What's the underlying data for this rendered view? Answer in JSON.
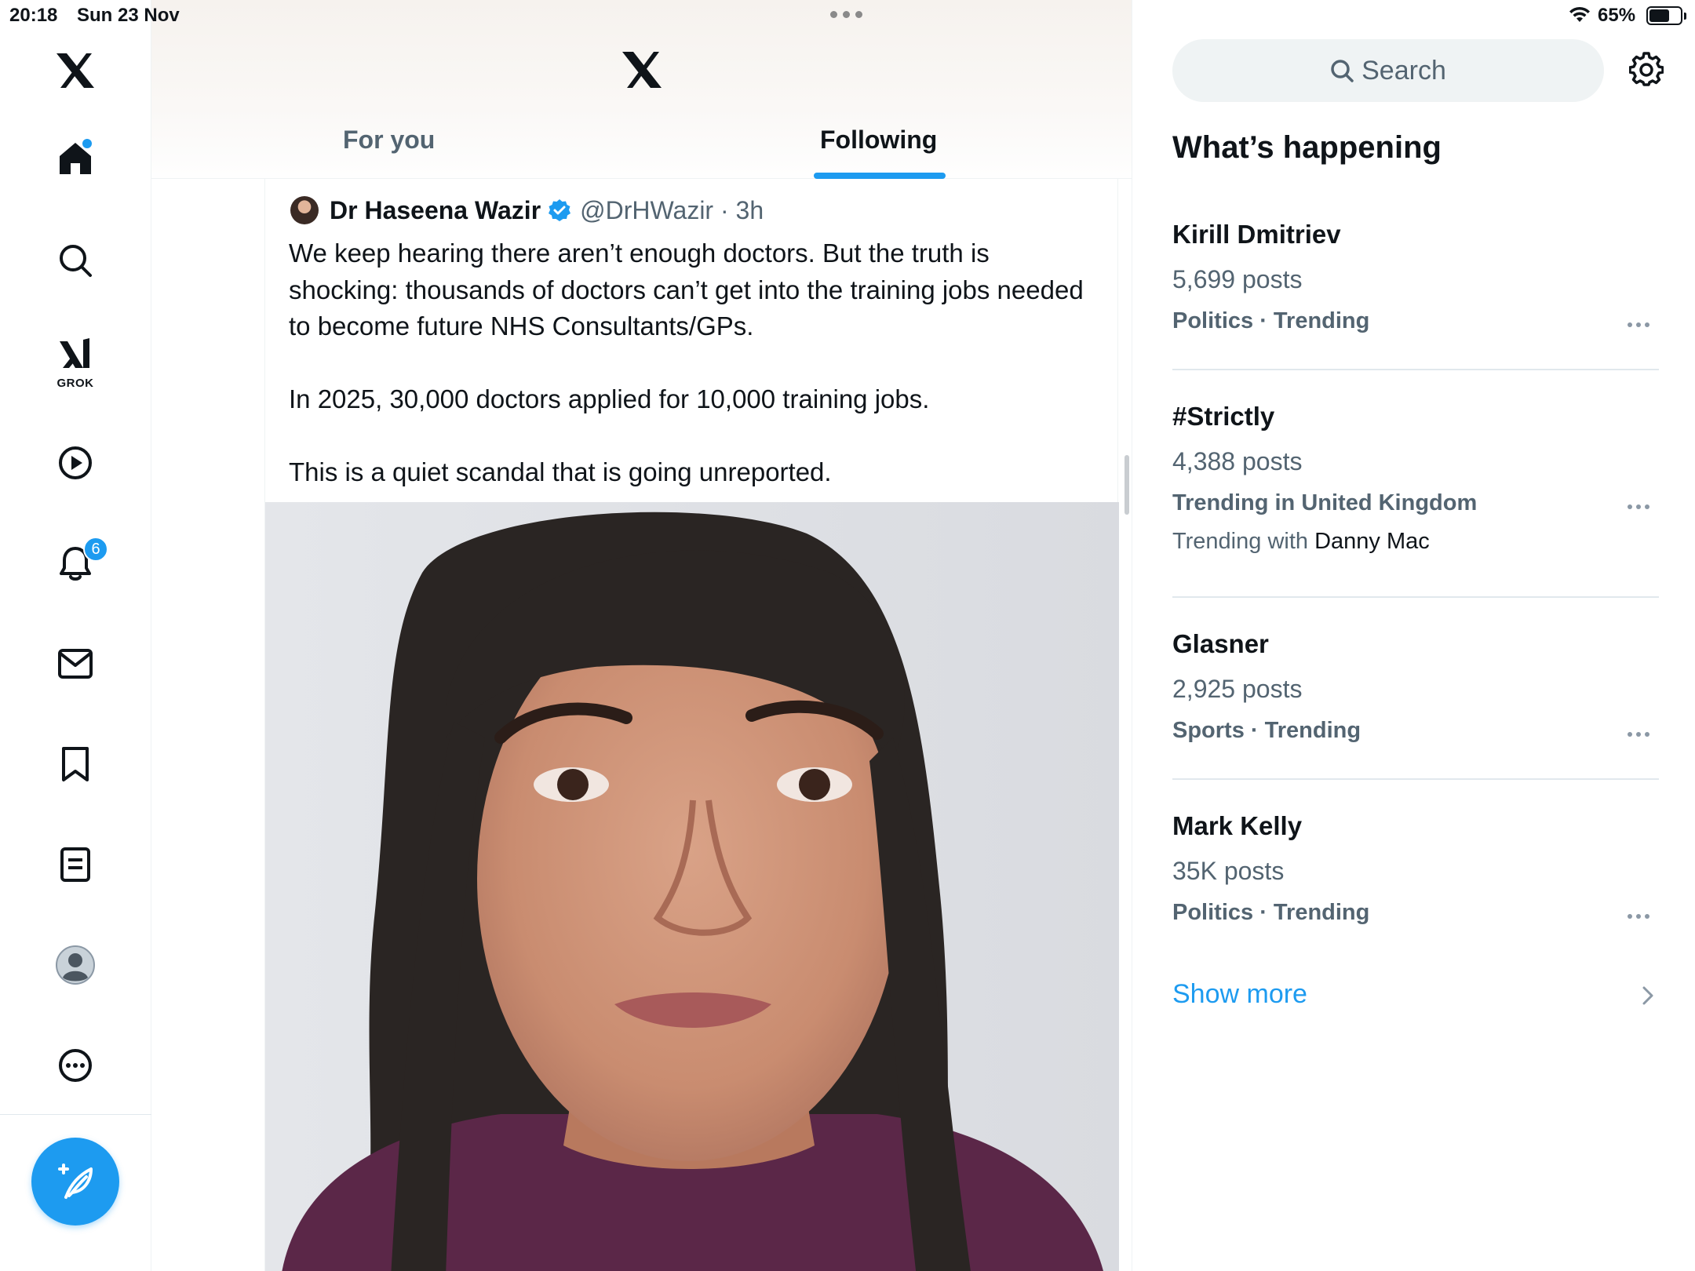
{
  "status_bar": {
    "time": "20:18",
    "date": "Sun 23 Nov",
    "battery_percent_label": "65%",
    "battery_level": 0.65
  },
  "sidebar": {
    "items": [
      {
        "name": "x-logo",
        "icon": "x-logo-icon"
      },
      {
        "name": "home",
        "icon": "home-icon",
        "has_dot": true
      },
      {
        "name": "explore",
        "icon": "search-icon"
      },
      {
        "name": "grok",
        "icon": "grok-icon",
        "label": "GROK"
      },
      {
        "name": "video",
        "icon": "play-icon"
      },
      {
        "name": "notifications",
        "icon": "bell-icon",
        "badge": "6"
      },
      {
        "name": "messages",
        "icon": "mail-icon"
      },
      {
        "name": "bookmarks",
        "icon": "bookmark-icon"
      },
      {
        "name": "lists",
        "icon": "list-icon"
      },
      {
        "name": "profile",
        "icon": "avatar-icon"
      },
      {
        "name": "more",
        "icon": "more-circle-icon"
      }
    ],
    "compose_icon": "compose-feather-icon"
  },
  "main": {
    "tabs": [
      {
        "label": "For you",
        "active": false
      },
      {
        "label": "Following",
        "active": true
      }
    ],
    "tweet": {
      "author_name": "Dr Haseena Wazir",
      "verified": true,
      "handle_time": "@DrHWazir · 3h",
      "text": "We keep hearing there aren’t enough doctors. But the truth is shocking: thousands of doctors can’t get into the training jobs needed to become future NHS Consultants/GPs.\n\nIn 2025, 30,000 doctors applied for 10,000 training jobs.\n\nThis is a quiet scandal that is going unreported."
    }
  },
  "right": {
    "search_placeholder": "Search",
    "section_title": "What’s happening",
    "trends": [
      {
        "name": "Kirill Dmitriev",
        "posts": "5,699 posts",
        "category": "Politics · Trending"
      },
      {
        "name": "#Strictly",
        "posts": "4,388 posts",
        "category": "Trending in United Kingdom",
        "with_prefix": "Trending with",
        "with_name": "Danny Mac"
      },
      {
        "name": "Glasner",
        "posts": "2,925 posts",
        "category": "Sports · Trending"
      },
      {
        "name": "Mark Kelly",
        "posts": "35K posts",
        "category": "Politics · Trending"
      }
    ],
    "show_more": "Show more"
  },
  "colors": {
    "accent": "#1d9bf0",
    "text_primary": "#0f1419",
    "text_secondary": "#536471"
  }
}
